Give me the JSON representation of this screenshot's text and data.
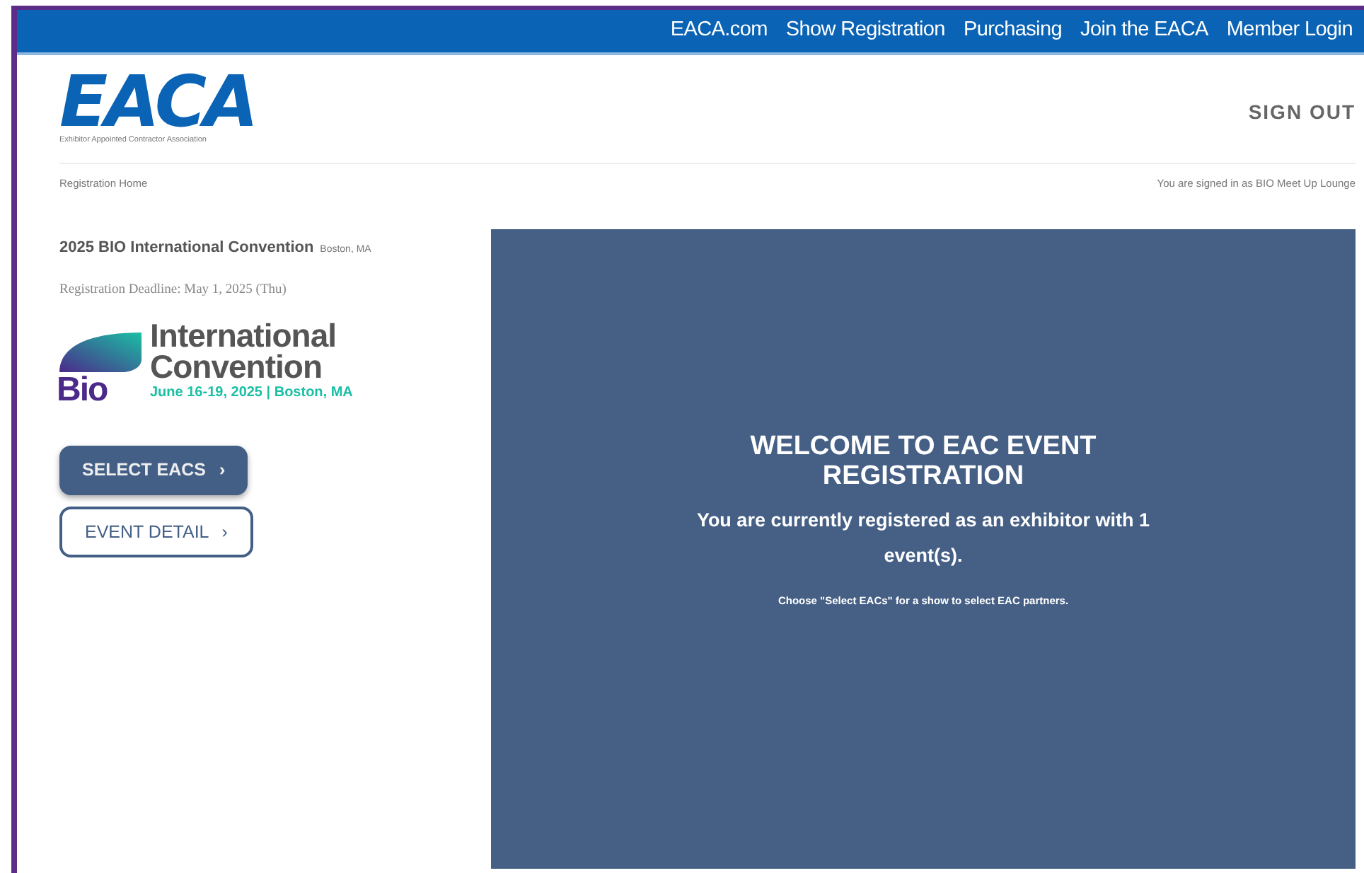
{
  "top_nav": [
    "EACA.com",
    "Show Registration",
    "Purchasing",
    "Join the EACA",
    "Member Login"
  ],
  "logo": {
    "text": "EACA",
    "tagline": "Exhibitor Appointed Contractor Association"
  },
  "sign_out": "SIGN OUT",
  "breadcrumb": "Registration Home",
  "signed_in": "You are signed in as BIO Meet Up Lounge",
  "event": {
    "title": "2025 BIO International Convention",
    "location": "Boston, MA",
    "deadline": "Registration Deadline: May 1, 2025 (Thu)",
    "event_logo": {
      "mark": "Bio",
      "line1": "International",
      "line2": "Convention",
      "dates": "June 16-19, 2025 | Boston, MA"
    }
  },
  "buttons": [
    {
      "label": "SELECT EACS",
      "icon": "›",
      "kind": "filled"
    },
    {
      "label": "EVENT DETAIL",
      "icon": "›",
      "kind": "outline"
    }
  ],
  "welcome": {
    "title": "WELCOME TO EAC EVENT REGISTRATION",
    "message": "You are currently registered as an exhibitor with 1 event(s).",
    "hint": "Choose \"Select EACs\" for a show to select EAC partners."
  }
}
